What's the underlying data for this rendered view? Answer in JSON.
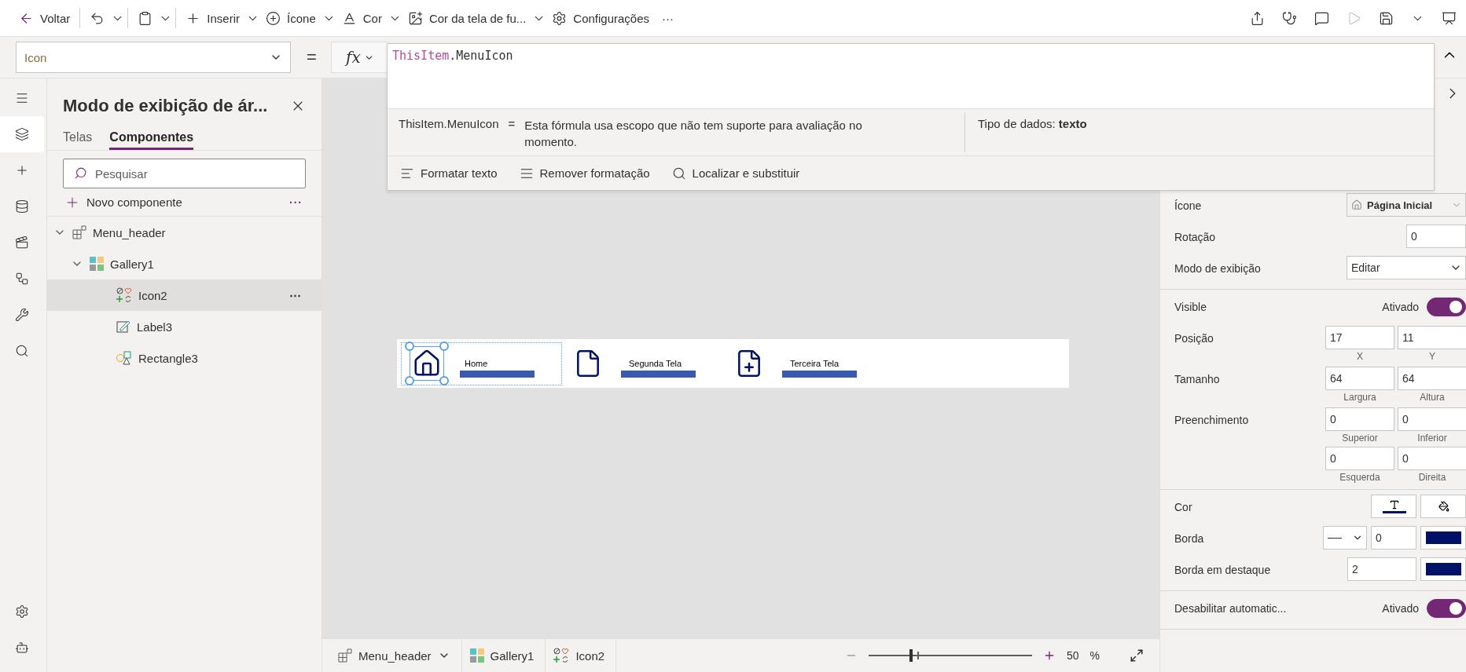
{
  "toolbar": {
    "items": [
      {
        "kind": "back",
        "label": "Voltar",
        "caret": false
      },
      {
        "kind": "undo",
        "caret": true
      },
      {
        "kind": "paste",
        "caret": true
      },
      {
        "kind": "insert",
        "label": "Inserir",
        "caret": true
      },
      {
        "kind": "icon",
        "label": "Ícone",
        "caret": true
      },
      {
        "kind": "color",
        "label": "Cor",
        "caret": true
      },
      {
        "kind": "background",
        "label": "Cor da tela de fu...",
        "caret": true
      },
      {
        "kind": "settings",
        "label": "Configurações",
        "caret": false
      },
      {
        "kind": "more",
        "label": "···",
        "caret": false
      }
    ]
  },
  "property_selector": {
    "value": "Icon"
  },
  "equals_sign": "=",
  "fx": "fx",
  "formula": {
    "object": "ThisItem",
    "member": ".MenuIcon",
    "result_expression": "ThisItem.MenuIcon",
    "result_equals": "=",
    "result_message": "Esta fórmula usa escopo que não tem suporte para avaliação no momento.",
    "data_type": "Tipo de dados: **texto**",
    "actions": [
      {
        "kind": "format",
        "label": "Formatar texto"
      },
      {
        "kind": "unformat",
        "label": "Remover formatação"
      },
      {
        "kind": "find",
        "label": "Localizar e substituir"
      }
    ]
  },
  "rail": [
    {
      "kind": "menu",
      "selected": false
    },
    {
      "kind": "layers",
      "selected": true
    },
    {
      "kind": "insert",
      "selected": false
    },
    {
      "kind": "data",
      "selected": false
    },
    {
      "kind": "media",
      "selected": false
    },
    {
      "kind": "flows",
      "selected": false
    },
    {
      "kind": "tools",
      "selected": false
    },
    {
      "kind": "search",
      "selected": false
    }
  ],
  "rail_bottom": [
    {
      "kind": "settings",
      "selected": false
    },
    {
      "kind": "bot",
      "selected": false
    }
  ],
  "tree_panel": {
    "title": "Modo de exibição de ár...",
    "tabs": [
      {
        "label": "Telas",
        "selected": false
      },
      {
        "label": "Componentes",
        "selected": true
      }
    ],
    "search": {
      "placeholder": "Pesquisar"
    },
    "new_component": "Novo componente",
    "more": "···",
    "nodes": [
      {
        "kind": "component",
        "label": "Menu_header",
        "expanded": true,
        "selected": false,
        "children": [
          {
            "kind": "gallery",
            "label": "Gallery1",
            "expanded": true,
            "selected": false,
            "children": [
              {
                "kind": "icon",
                "label": "Icon2",
                "selected": true,
                "more": "⋯"
              },
              {
                "kind": "label",
                "label": "Label3",
                "selected": false
              },
              {
                "kind": "rectangle",
                "label": "Rectangle3",
                "selected": false
              }
            ]
          }
        ]
      }
    ]
  },
  "canvas": {
    "items": [
      {
        "kind": "home",
        "label": "Home",
        "selected": true
      },
      {
        "kind": "document",
        "label": "Segunda Tela",
        "selected": false
      },
      {
        "kind": "document-add",
        "label": "Terceira Tela",
        "selected": false
      }
    ]
  },
  "properties": {
    "sections": [
      [
        {
          "kind": "icon-select",
          "label": "Ícone",
          "value": "Página Inicial"
        },
        {
          "kind": "number",
          "label": "Rotação",
          "value": "0"
        },
        {
          "kind": "select",
          "label": "Modo de exibição",
          "value": "Editar"
        }
      ],
      [
        {
          "kind": "toggle",
          "label": "Visible",
          "state": "Ativado",
          "on": true
        },
        {
          "kind": "pair",
          "label": "Posição",
          "fields": [
            {
              "value": "17",
              "caption": "X"
            },
            {
              "value": "11",
              "caption": "Y"
            }
          ]
        },
        {
          "kind": "pair",
          "label": "Tamanho",
          "fields": [
            {
              "value": "64",
              "caption": "Largura"
            },
            {
              "value": "64",
              "caption": "Altura"
            }
          ]
        },
        {
          "kind": "pair",
          "label": "Preenchimento",
          "fields": [
            {
              "value": "0",
              "caption": "Superior"
            },
            {
              "value": "0",
              "caption": "Inferior"
            },
            {
              "value": "0",
              "caption": "Esquerda"
            },
            {
              "value": "0",
              "caption": "Direita"
            }
          ]
        }
      ],
      [
        {
          "kind": "color",
          "label": "Cor",
          "color": "#001166"
        },
        {
          "kind": "border",
          "label": "Borda",
          "value": "0",
          "color": "#001166"
        },
        {
          "kind": "focus-border",
          "label": "Borda em destaque",
          "value": "2",
          "color": "#001166"
        }
      ],
      [
        {
          "kind": "toggle",
          "label": "Desabilitar automatic...",
          "state": "Ativado",
          "on": true
        }
      ]
    ]
  },
  "breadcrumb": [
    {
      "kind": "component",
      "label": "Menu_header",
      "caret": true
    },
    {
      "kind": "gallery",
      "label": "Gallery1",
      "caret": false
    },
    {
      "kind": "icon",
      "label": "Icon2",
      "caret": false
    }
  ],
  "zoom": {
    "level": 0.25,
    "value": "50",
    "unit": "%"
  }
}
